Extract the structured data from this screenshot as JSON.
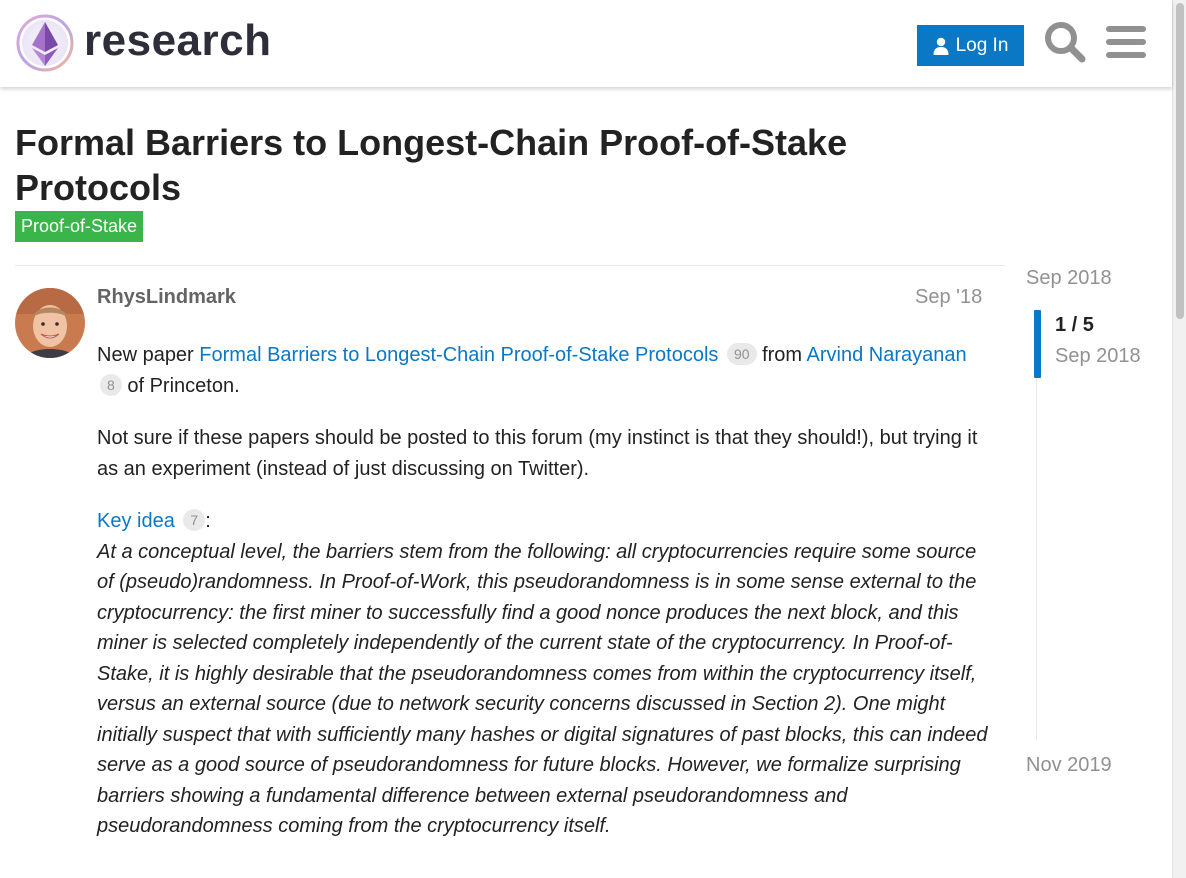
{
  "header": {
    "site_name": "research",
    "login_label": "Log In",
    "icons": {
      "logo": "ethereum-research-logo",
      "login": "user-icon",
      "search": "search-icon",
      "menu": "hamburger-menu-icon"
    },
    "accent_color": "#0a78c4"
  },
  "topic": {
    "title": "Formal Barriers to Longest-Chain Proof-of-Stake Protocols",
    "category": "Proof-of-Stake",
    "category_color": "#3ab54a"
  },
  "post": {
    "username": "RhysLindmark",
    "date": "Sep '18",
    "p1": {
      "t1": "New paper ",
      "link1": "Formal Barriers to Longest-Chain Proof-of-Stake Protocols",
      "link1_count": "90",
      "t2": " from ",
      "link2": "Arvind Narayanan",
      "link2_count": "8",
      "t3": " of Princeton."
    },
    "p2": "Not sure if these papers should be posted to this forum (my instinct is that they should!), but trying it as an experiment (instead of just discussing on Twitter).",
    "p3": {
      "link": "Key idea",
      "link_count": "7",
      "after_link": ":",
      "quote": "At a conceptual level, the barriers stem from the following: all cryptocurrencies require some source of (pseudo)randomness. In Proof-of-Work, this pseudorandomness is in some sense external to the cryptocurrency: the first miner to successfully find a good nonce produces the next block, and this miner is selected completely independently of the current state of the cryptocurrency. In Proof-of-Stake, it is highly desirable that the pseudorandomness comes from within the cryptocurrency itself, versus an external source (due to network security concerns discussed in Section 2). One might initially suspect that with sufficiently many hashes or digital signatures of past blocks, this can indeed serve as a good source of pseudorandomness for future blocks. However, we formalize surprising barriers showing a fundamental difference between external pseudorandomness and pseudorandomness coming from the cryptocurrency itself."
    }
  },
  "timeline": {
    "start_date": "Sep 2018",
    "progress": "1 / 5",
    "progress_date": "Sep 2018",
    "end_date": "Nov 2019"
  }
}
